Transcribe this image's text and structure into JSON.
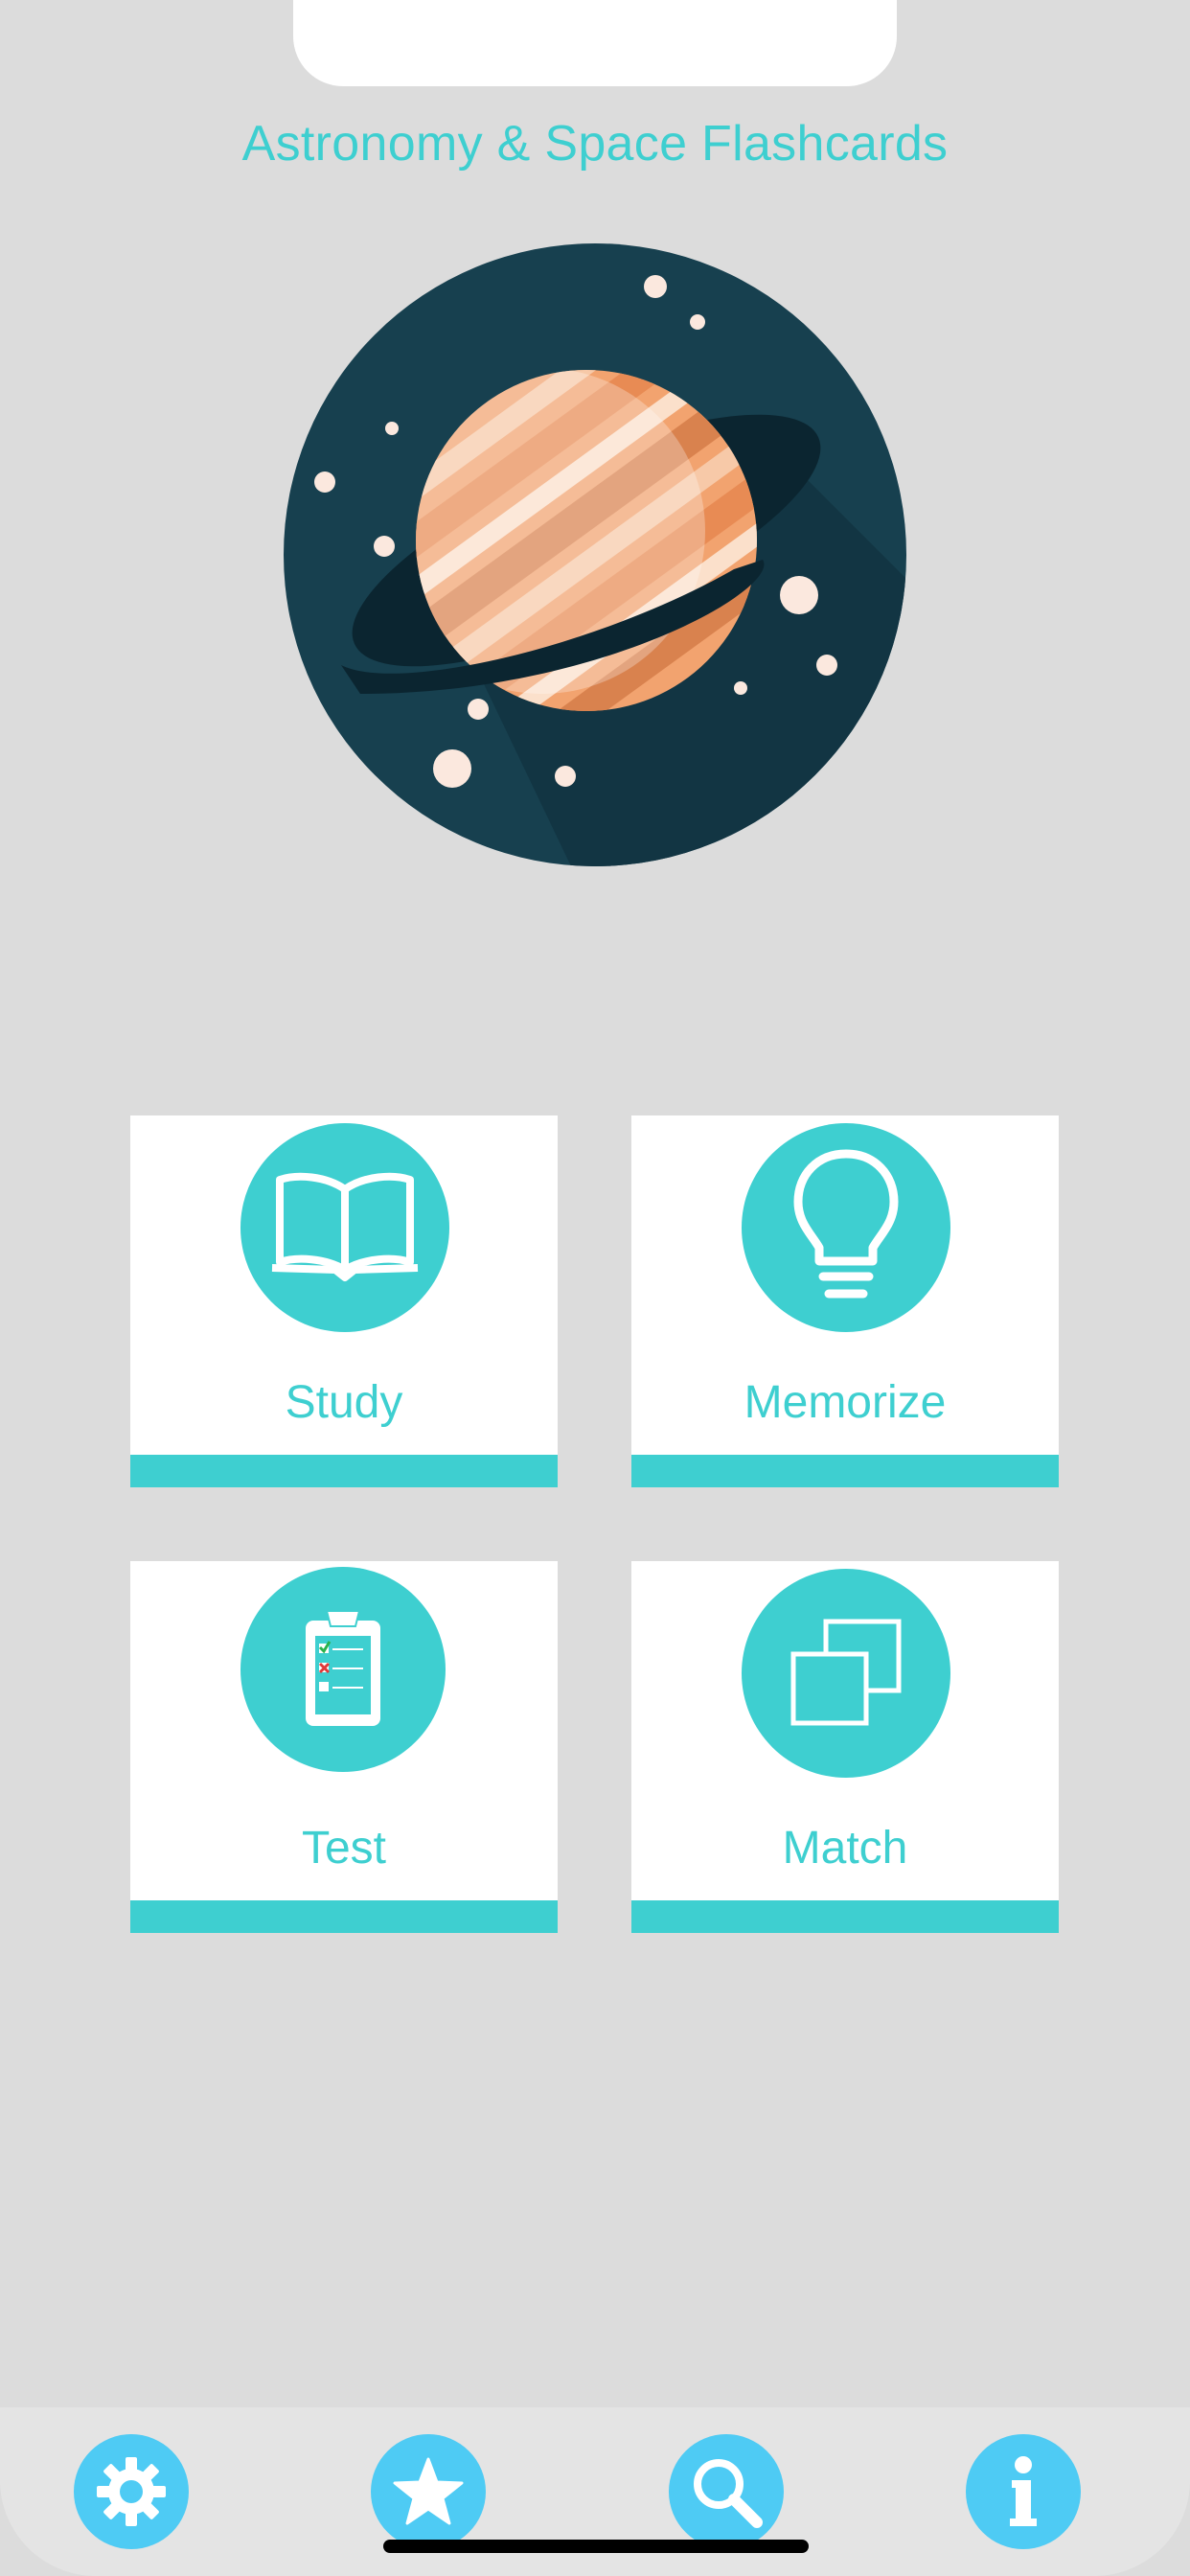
{
  "app": {
    "title": "Astronomy & Space Flashcards"
  },
  "colors": {
    "accent": "#3ecfd0",
    "tab_icon": "#4ecbf4",
    "background": "#dcdcdc",
    "planet_bg": "#17404f"
  },
  "menu": {
    "study": {
      "label": "Study",
      "icon": "open-book-icon"
    },
    "memorize": {
      "label": "Memorize",
      "icon": "lightbulb-icon"
    },
    "test": {
      "label": "Test",
      "icon": "clipboard-checklist-icon"
    },
    "match": {
      "label": "Match",
      "icon": "overlapping-squares-icon"
    }
  },
  "tabbar": {
    "items": [
      {
        "icon": "gear-icon"
      },
      {
        "icon": "star-icon"
      },
      {
        "icon": "search-icon"
      },
      {
        "icon": "info-icon"
      }
    ]
  }
}
